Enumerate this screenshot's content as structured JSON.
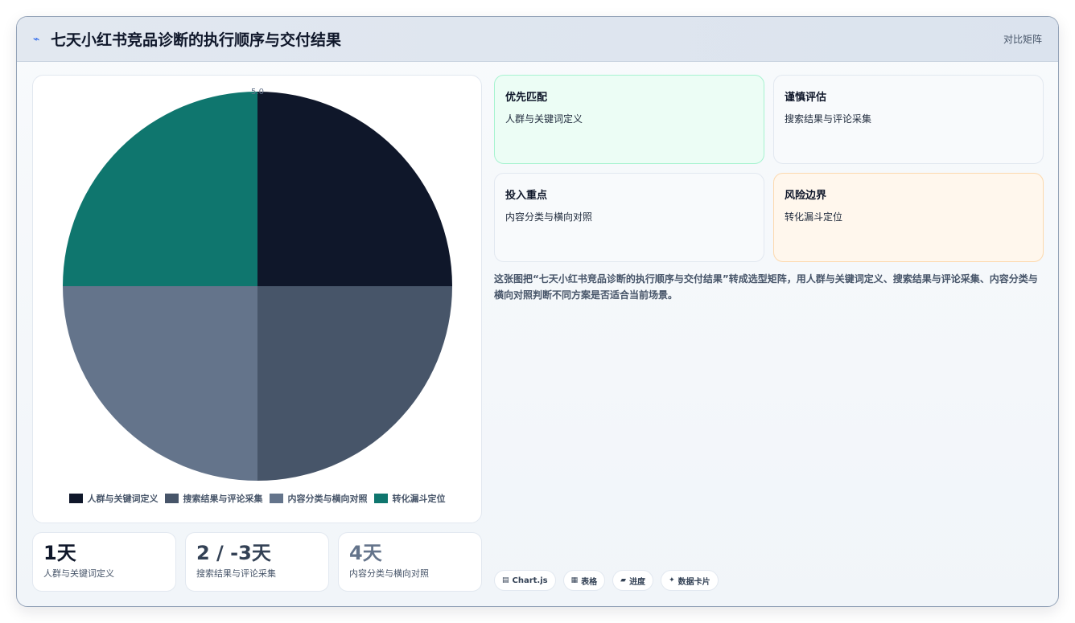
{
  "header": {
    "icon": "lightning-icon",
    "title": "七天小红书竞品诊断的执行顺序与交付结果",
    "tag": "对比矩阵"
  },
  "chart_data": {
    "type": "pie",
    "categories": [
      "人群与关键词定义",
      "搜索结果与评论采集",
      "内容分类与横向对照",
      "转化漏斗定位"
    ],
    "values": [
      1,
      1,
      1,
      1
    ],
    "colors": [
      "#0f172a",
      "#475569",
      "#64748b",
      "#0f766e"
    ],
    "top_label": "5.0",
    "legend_position": "bottom"
  },
  "stats": [
    {
      "value": "1天",
      "label": "人群与关键词定义",
      "color": "#0f172a"
    },
    {
      "value": "2 / -3天",
      "label": "搜索结果与评论采集",
      "color": "#334155"
    },
    {
      "value": "4天",
      "label": "内容分类与横向对照",
      "color": "#64748b"
    }
  ],
  "quadrants": [
    {
      "title": "优先匹配",
      "desc": "人群与关键词定义"
    },
    {
      "title": "谨慎评估",
      "desc": "搜索结果与评论采集"
    },
    {
      "title": "投入重点",
      "desc": "内容分类与横向对照"
    },
    {
      "title": "风险边界",
      "desc": "转化漏斗定位"
    }
  ],
  "description": "这张图把“七天小红书竞品诊断的执行顺序与交付结果”转成选型矩阵，用人群与关键词定义、搜索结果与评论采集、内容分类与横向对照判断不同方案是否适合当前场景。",
  "chips": [
    {
      "icon": "chart-icon",
      "label": "Chart.js"
    },
    {
      "icon": "table-icon",
      "label": "表格"
    },
    {
      "icon": "progress-icon",
      "label": "进度"
    },
    {
      "icon": "sparkle-icon",
      "label": "数据卡片"
    }
  ]
}
